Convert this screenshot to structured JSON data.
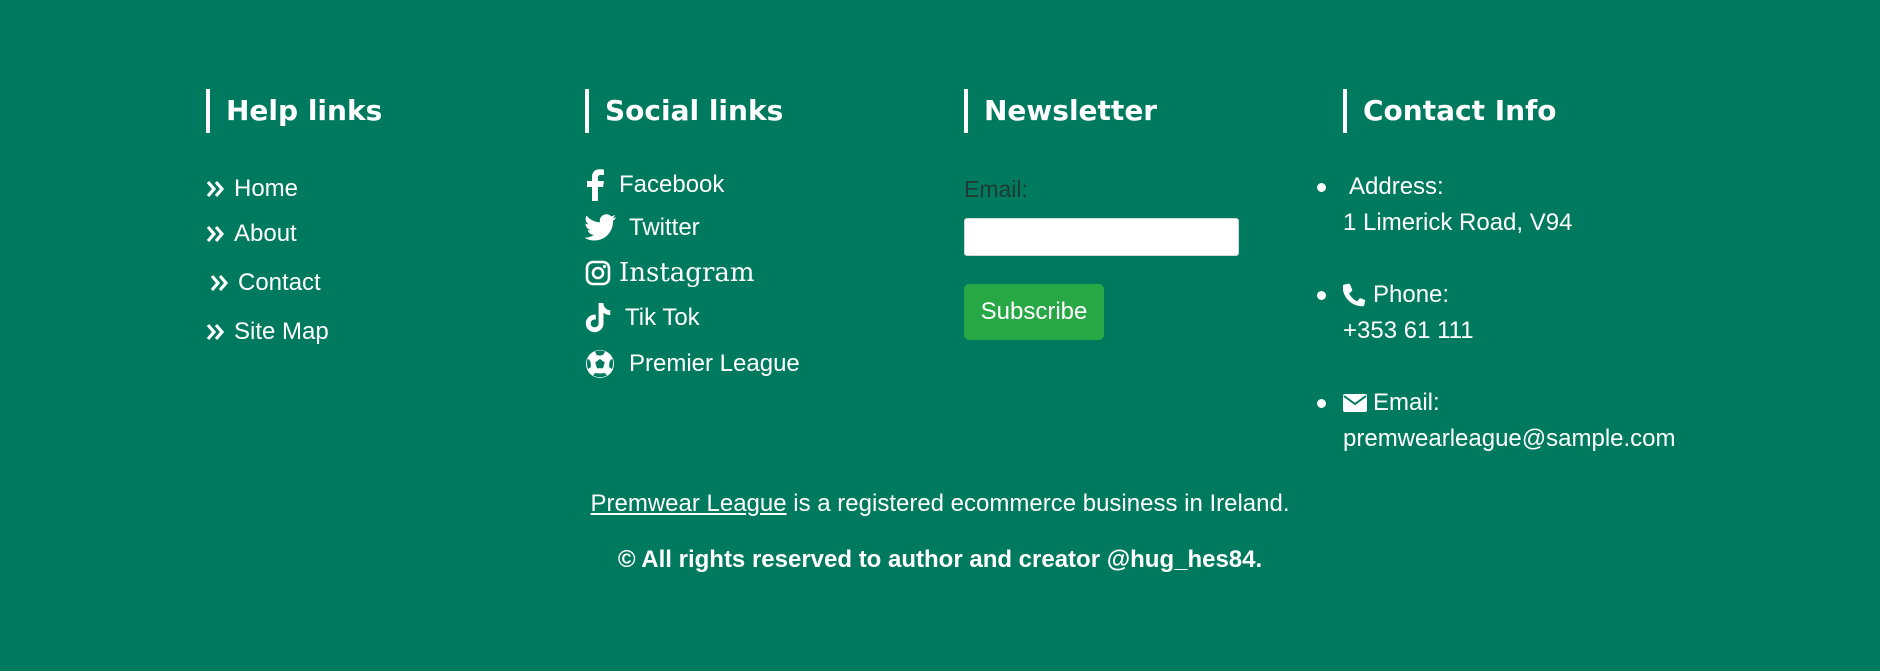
{
  "help": {
    "title": "Help links",
    "items": [
      {
        "label": "Home",
        "icon": "double-chevron-right-icon"
      },
      {
        "label": "About",
        "icon": "double-chevron-right-icon"
      },
      {
        "label": "Contact",
        "icon": "double-chevron-right-icon"
      },
      {
        "label": "Site Map",
        "icon": "double-chevron-right-icon"
      }
    ]
  },
  "social": {
    "title": "Social links",
    "items": [
      {
        "label": "Facebook",
        "icon": "facebook-icon"
      },
      {
        "label": "Twitter",
        "icon": "twitter-icon"
      },
      {
        "label": "Instagram",
        "icon": "instagram-icon"
      },
      {
        "label": "Tik Tok",
        "icon": "tiktok-icon"
      },
      {
        "label": "Premier League",
        "icon": "soccer-ball-icon"
      }
    ]
  },
  "newsletter": {
    "title": "Newsletter",
    "email_label": "Email:",
    "email_value": "",
    "subscribe_label": "Subscribe"
  },
  "contact": {
    "title": "Contact Info",
    "items": [
      {
        "label": "Address:",
        "value": "1 Limerick Road, V94",
        "icon": ""
      },
      {
        "label": "Phone:",
        "value": "+353 61 111",
        "icon": "phone-icon"
      },
      {
        "label": "Email:",
        "value": "premwearleague@sample.com",
        "icon": "envelope-icon"
      }
    ]
  },
  "bottom": {
    "brand_link": "Premwear League",
    "tagline_rest": " is a registered ecommerce business in Ireland.",
    "copyright": "© All rights reserved to author and creator  @hug_hes84."
  },
  "colors": {
    "background": "#007a5e",
    "text": "#ffffff",
    "subscribe_button": "#28a745",
    "email_label": "#1f3a34"
  }
}
